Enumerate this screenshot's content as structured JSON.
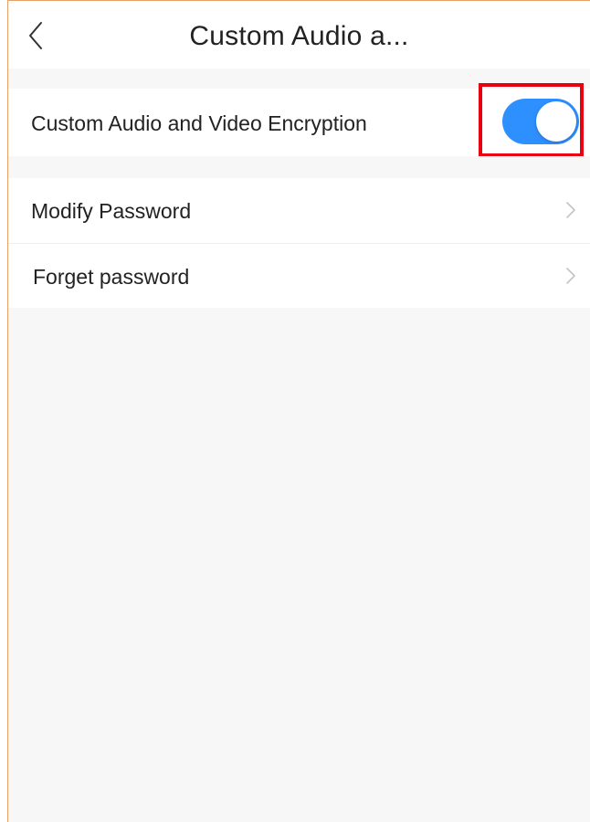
{
  "header": {
    "title": "Custom Audio a...",
    "back_icon": "chevron-left-icon"
  },
  "settings": {
    "encryption": {
      "label": "Custom Audio and Video Encryption",
      "enabled": true,
      "toggle_color": "#2e8fff",
      "highlight_color": "#e60012"
    },
    "items": [
      {
        "label": "Modify Password",
        "icon": "chevron-right-icon"
      },
      {
        "label": "Forget password",
        "icon": "chevron-right-icon"
      }
    ]
  },
  "colors": {
    "background": "#f7f7f7",
    "row": "#ffffff",
    "text": "#222222",
    "chevron": "#c4c4c4"
  }
}
